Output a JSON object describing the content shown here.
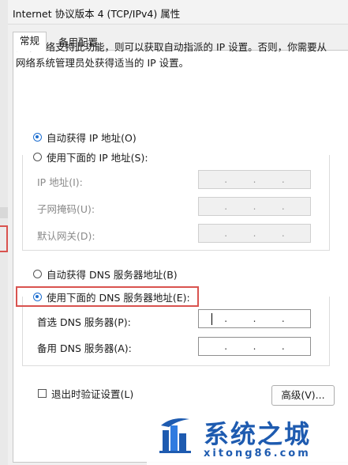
{
  "window": {
    "title": "Internet 协议版本 4 (TCP/IPv4) 属性"
  },
  "tabs": [
    {
      "label": "常规"
    },
    {
      "label": "备用配置"
    }
  ],
  "intro": "如果网络支持此功能，则可以获取自动指派的 IP 设置。否则，你需要从网络系统管理员处获得适当的 IP 设置。",
  "ip_section": {
    "auto_label": "自动获得 IP 地址(O)",
    "manual_label": "使用下面的 IP 地址(S):",
    "fields": [
      {
        "label": "IP 地址(I):"
      },
      {
        "label": "子网掩码(U):"
      },
      {
        "label": "默认网关(D):"
      }
    ]
  },
  "dns_section": {
    "auto_label": "自动获得 DNS 服务器地址(B)",
    "manual_label": "使用下面的 DNS 服务器地址(E):",
    "fields": [
      {
        "label": "首选 DNS 服务器(P):"
      },
      {
        "label": "备用 DNS 服务器(A):"
      }
    ]
  },
  "ip_dot": ".",
  "validate_label": "退出时验证设置(L)",
  "advanced_button": "高级(V)...",
  "watermark": {
    "main": "系统之城",
    "url": "xitong86.com"
  },
  "colors": {
    "accent": "#1f6fd0",
    "highlight": "#d9534f",
    "brand": "#1e5bb0"
  }
}
